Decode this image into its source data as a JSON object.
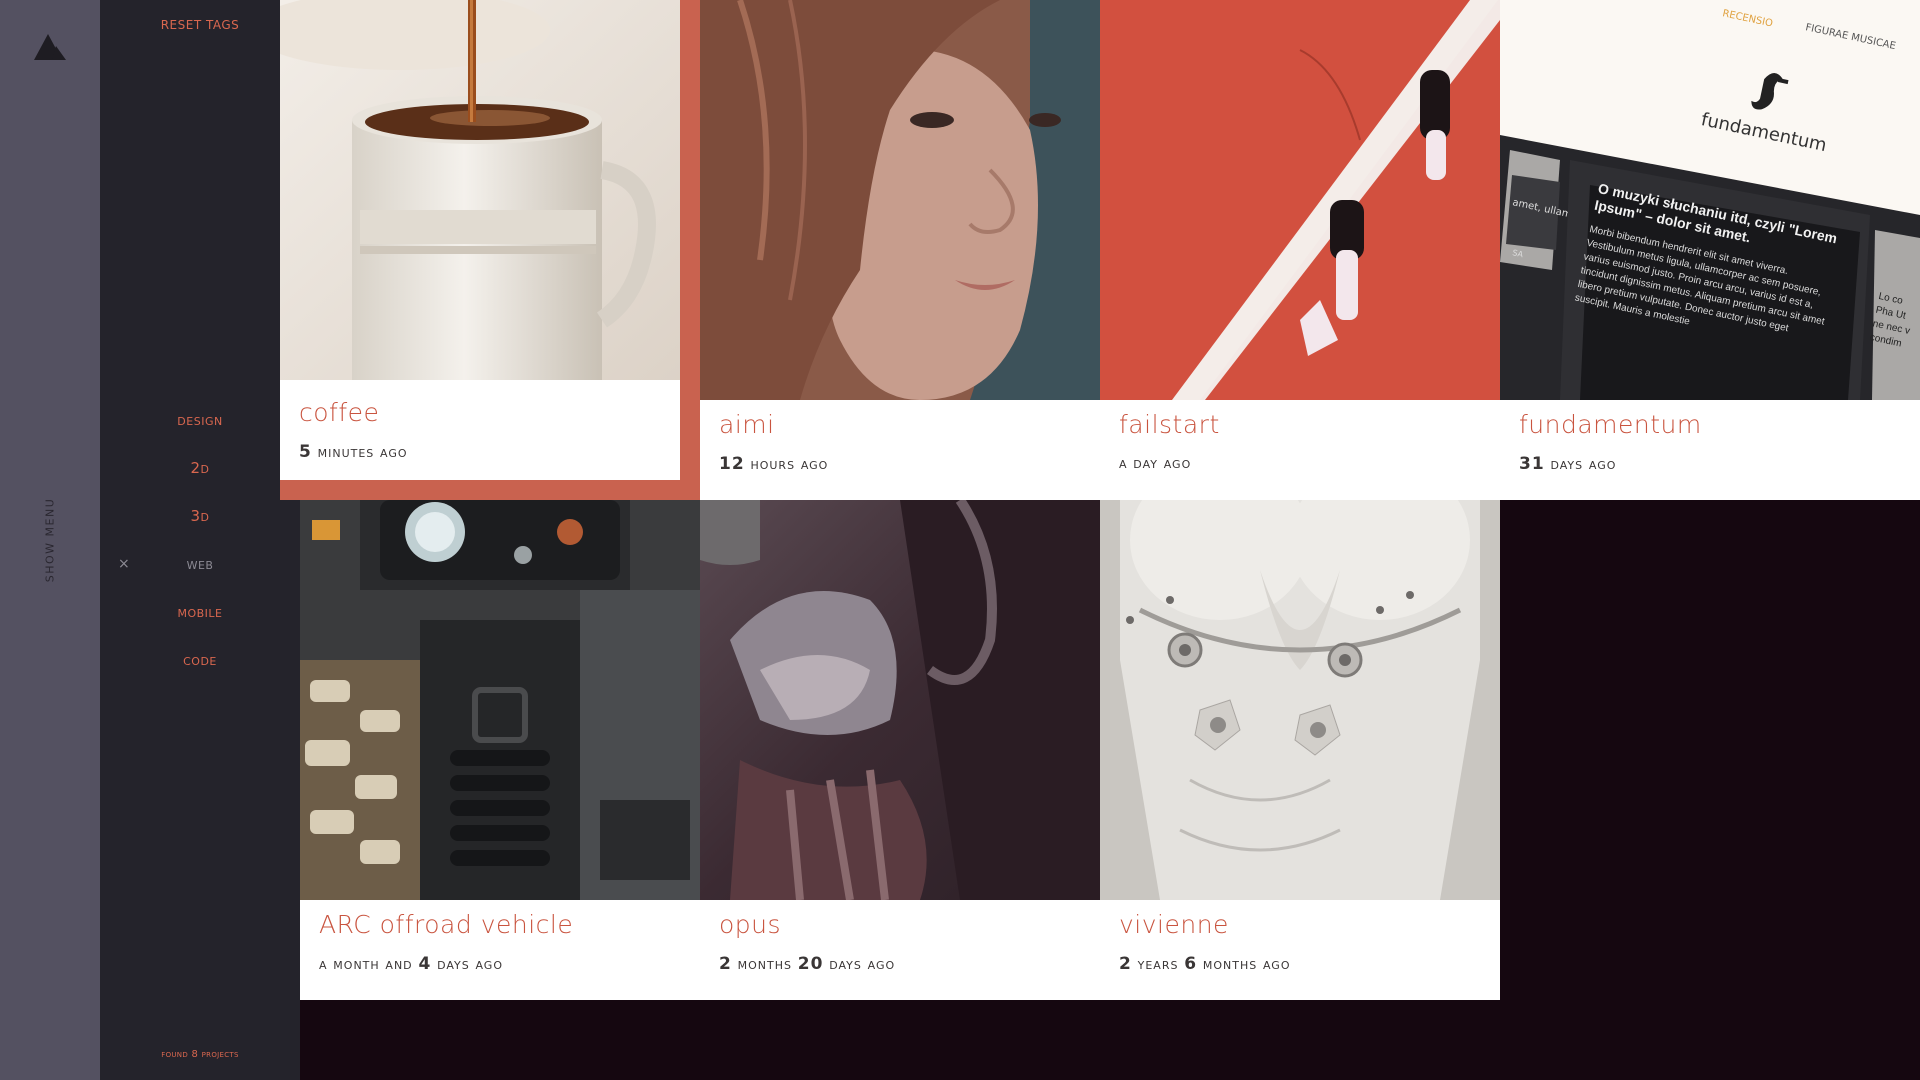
{
  "sidebar": {
    "show_menu": "SHOW MENU",
    "logo": "triangle-logo-icon"
  },
  "tags": {
    "reset_label": "RESET TAGS",
    "items": [
      {
        "label": "design",
        "selected": false
      },
      {
        "label": "2d",
        "selected": false
      },
      {
        "label": "3d",
        "selected": false
      },
      {
        "label": "web",
        "selected": true
      },
      {
        "label": "mobile",
        "selected": false
      },
      {
        "label": "code",
        "selected": false
      }
    ],
    "deselect_glyph": "×",
    "found_label": "found 8 projects"
  },
  "projects": [
    {
      "title": "coffee",
      "ago_num": "5",
      "ago_text": "minutes ago",
      "active": true
    },
    {
      "title": "aimi",
      "ago_num": "12",
      "ago_text": "hours ago"
    },
    {
      "title": "failstart",
      "ago_num": "",
      "ago_text": "a day ago"
    },
    {
      "title": "fundamentum",
      "ago_num": "31",
      "ago_text": "days ago"
    },
    {
      "title": "ARC offroad vehicle",
      "ago_text_1": "a month and",
      "ago_num": "4",
      "ago_text": "days ago"
    },
    {
      "title": "opus",
      "ago_num": "2",
      "ago_text_1": "months",
      "ago_num2": "20",
      "ago_text": "days ago"
    },
    {
      "title": "vivienne",
      "ago_num": "2",
      "ago_text_1": "years",
      "ago_num2": "6",
      "ago_text": "months ago"
    }
  ],
  "fundamentum_art": {
    "nav_a": "RECENSIO",
    "nav_b": "FIGURAE MUSICAE",
    "brand": "fundamentum",
    "heading": "O muzyki słuchaniu itd, czyli \"Lorem Ipsum\" – dolor sit amet.",
    "body": "Morbi bibendum hendrerit elit sit amet viverra. Vestibulum metus ligula, ullamcorper ac sem posuere, varius euismod justo. Proin arcu arcu, varius id est a, tincidunt dignissim metus. Aliquam pretium arcu sit amet libero pretium vulputate. Donec auctor justo eget suscipit. Mauris a molestie",
    "side_text": "amet, ullam",
    "side_text_2": "SA",
    "right_text": "Lo co Pha Ut ne nec v condim"
  },
  "colors": {
    "accent": "#c9543f",
    "rail": "#545161",
    "panel": "#24232b",
    "background": "#150710"
  }
}
